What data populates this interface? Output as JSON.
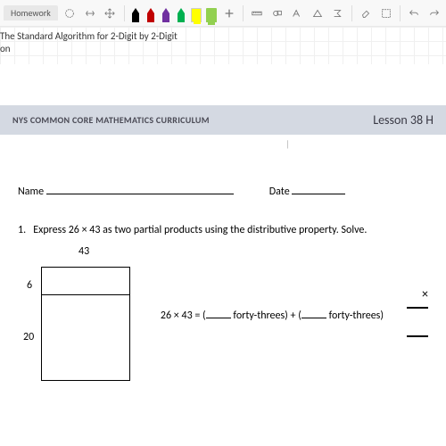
{
  "tab": {
    "label": "Homework"
  },
  "subtitle": {
    "line1": "The Standard Algorithm for 2-Digit by 2-Digit",
    "line2": "on"
  },
  "header": {
    "curriculum": "NYS COMMON CORE MATHEMATICS CURRICULUM",
    "lesson": "Lesson 38 H"
  },
  "form": {
    "name_label": "Name",
    "date_label": "Date"
  },
  "q1": {
    "num": "1.",
    "text": "Express 26 × 43 as two partial products using the distributive property.  Solve."
  },
  "model": {
    "top": "43",
    "side_a": "6",
    "side_b": "20"
  },
  "expr": {
    "lhs": "26 × 43 = (",
    "word1": " forty-threes) + (",
    "word2": " forty-threes)"
  },
  "mult": {
    "times": "×"
  },
  "icons": {
    "lasso": "lasso-icon",
    "insert": "insert-space-icon",
    "move": "move-icon",
    "plus": "add-icon",
    "ruler": "ruler-icon",
    "shapes": "shapes-icon",
    "ink1": "ink-to-text-icon",
    "ink2": "ink-to-shape-icon",
    "math": "ink-to-math-icon",
    "eraser": "eraser-icon",
    "select": "selection-icon",
    "undo": "undo-icon",
    "redo": "redo-icon"
  },
  "colors": {
    "pen_black": "#000000",
    "pen_red": "#c00000",
    "pen_purple": "#7030a0",
    "pen_green": "#00b050",
    "hl_yellow": "#ffff00",
    "hl_green": "#92d050"
  }
}
